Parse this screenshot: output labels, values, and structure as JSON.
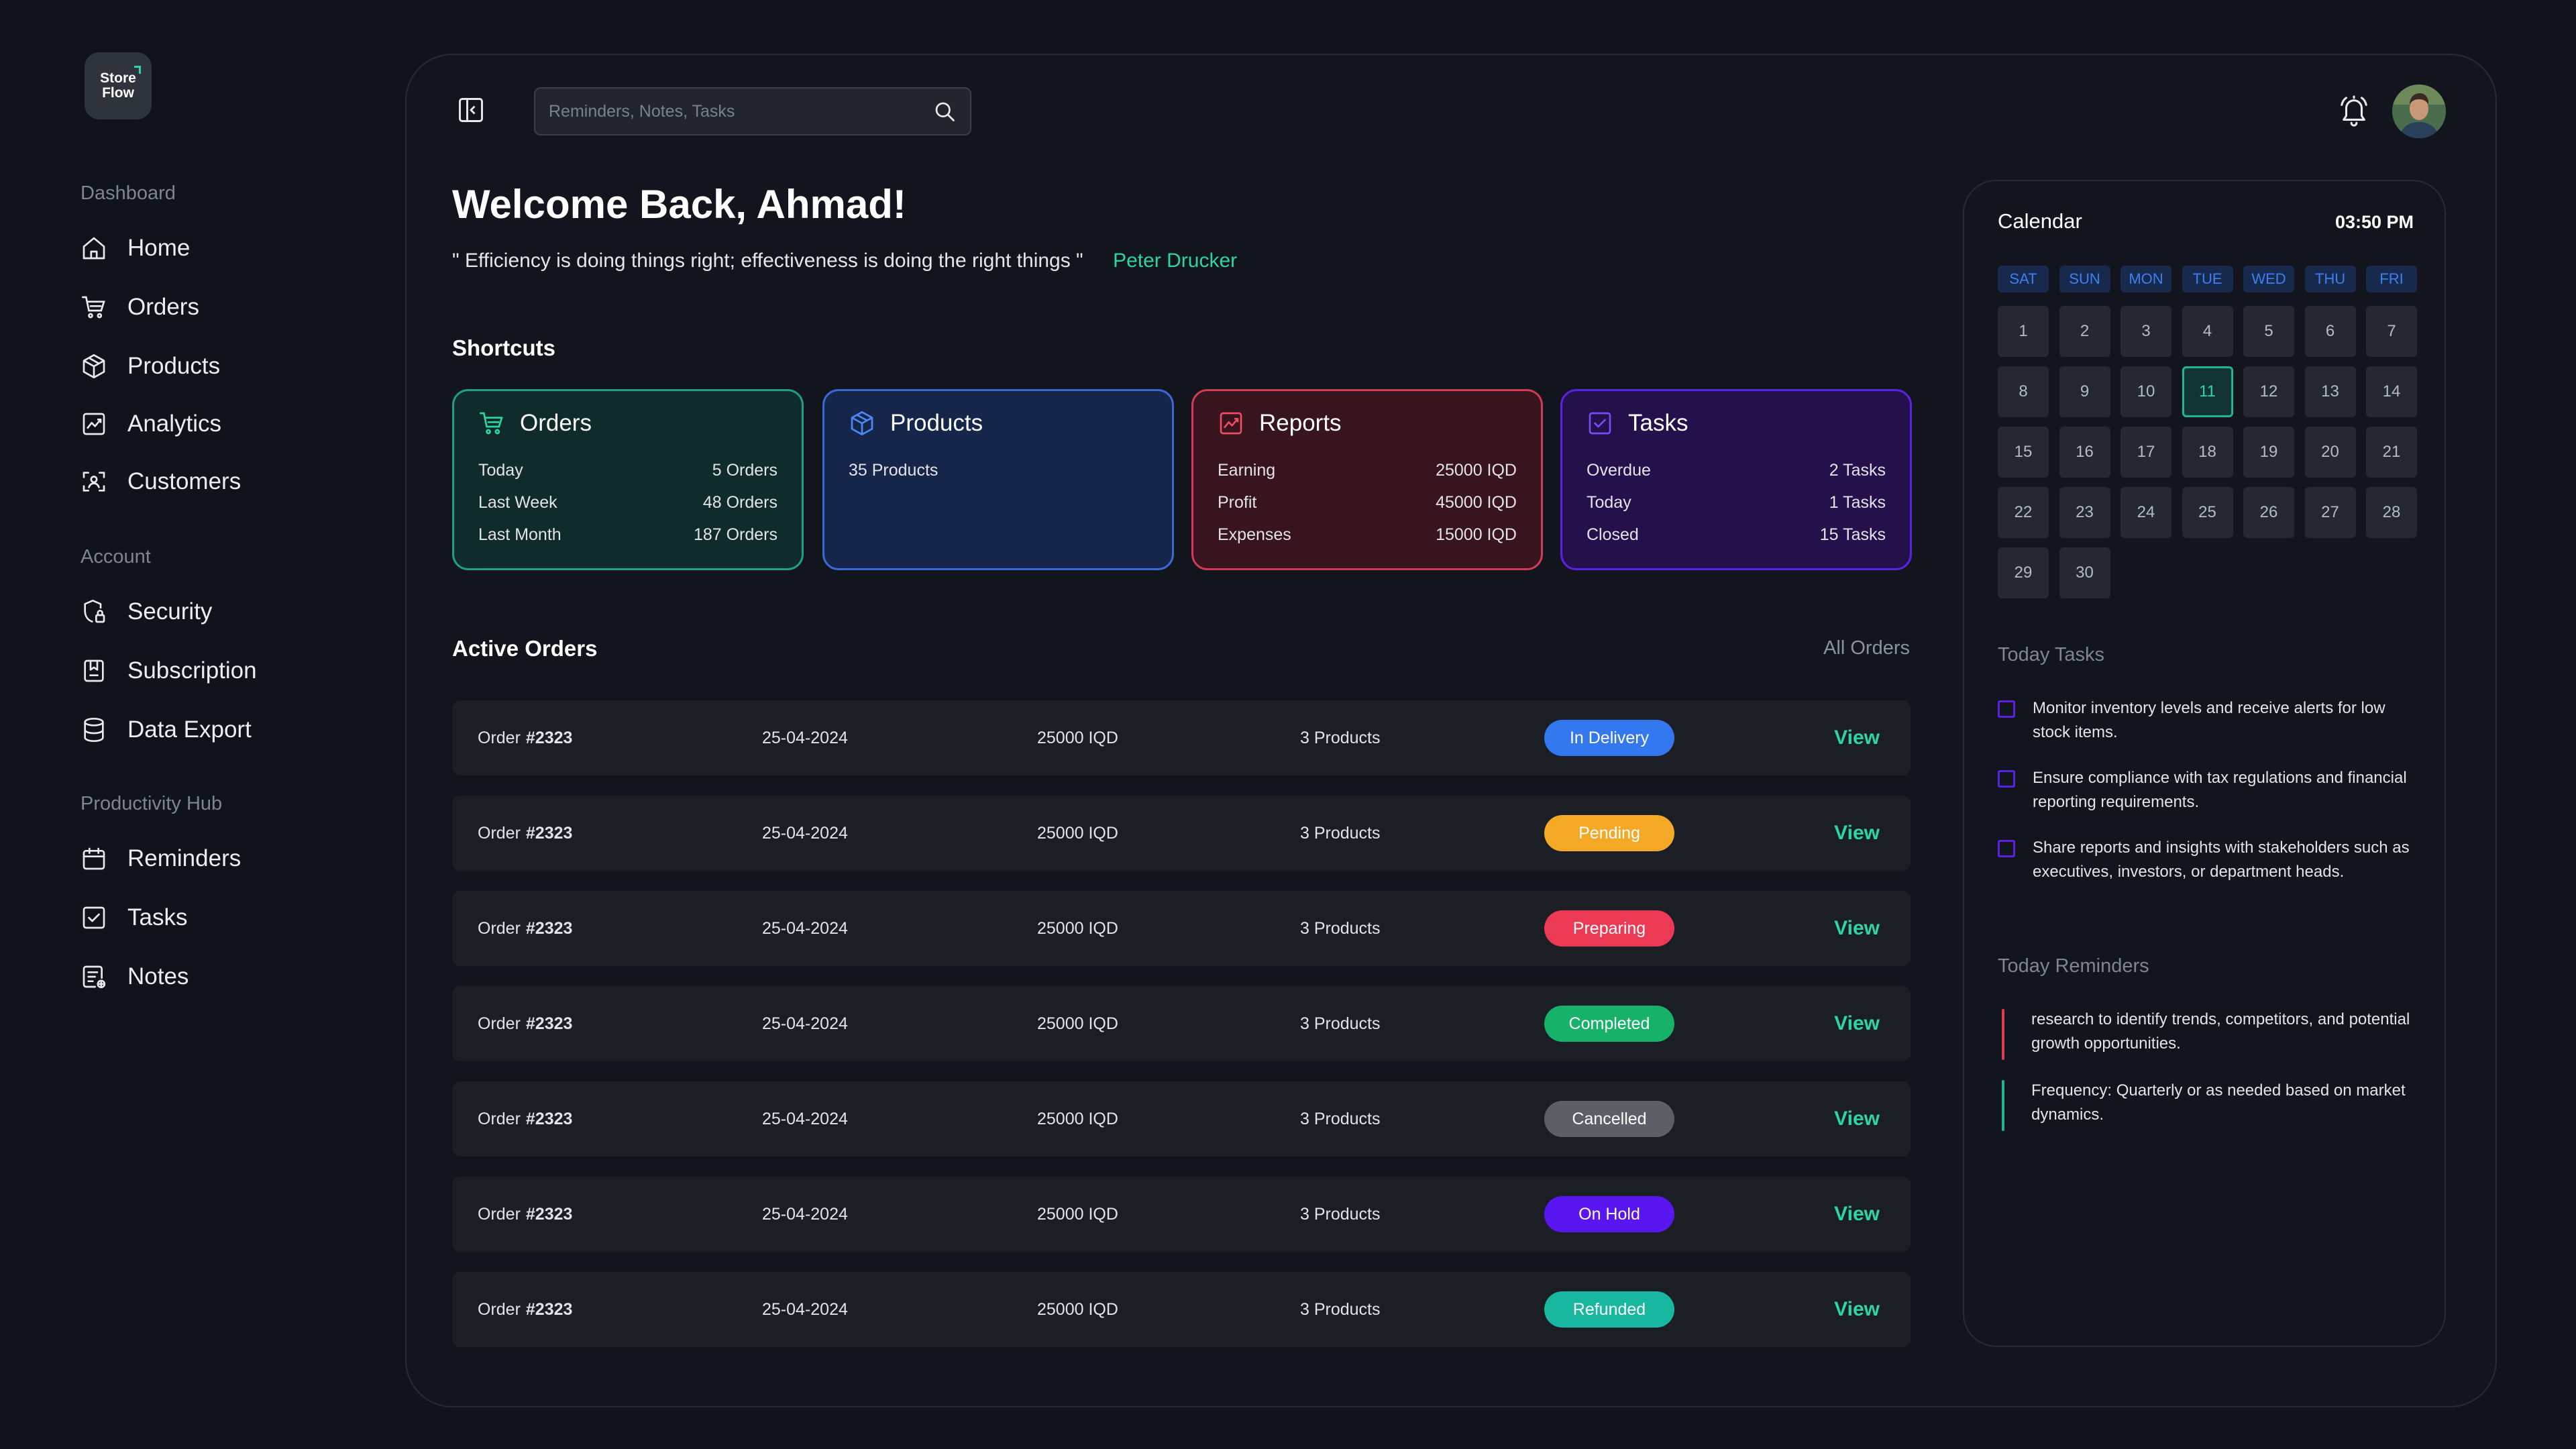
{
  "logo": {
    "line1": "Store",
    "line2": "Flow"
  },
  "sidebar": {
    "sections": [
      {
        "label": "Dashboard",
        "items": [
          "Home",
          "Orders",
          "Products",
          "Analytics",
          "Customers"
        ]
      },
      {
        "label": "Account",
        "items": [
          "Security",
          "Subscription",
          "Data Export"
        ]
      },
      {
        "label": "Productivity Hub",
        "items": [
          "Reminders",
          "Tasks",
          "Notes"
        ]
      }
    ],
    "icons": {
      "Home": "home-icon",
      "Orders": "cart-icon",
      "Products": "box-icon",
      "Analytics": "chart-icon",
      "Customers": "user-scan-icon",
      "Security": "shield-lock-icon",
      "Subscription": "bookmark-icon",
      "Data Export": "database-icon",
      "Reminders": "calendar-icon",
      "Tasks": "checkbox-icon",
      "Notes": "notes-icon"
    }
  },
  "header": {
    "search_placeholder": "Reminders, Notes, Tasks",
    "icons": [
      "sidebar-toggle-icon",
      "search-icon",
      "bell-icon"
    ]
  },
  "welcome": {
    "title": "Welcome Back, Ahmad!",
    "quote": "\" Efficiency is doing things right; effectiveness is doing the right things \"",
    "author": "Peter Drucker"
  },
  "shortcuts": {
    "title": "Shortcuts",
    "orders": {
      "label": "Orders",
      "rows": [
        [
          "Today",
          "5 Orders"
        ],
        [
          "Last Week",
          "48 Orders"
        ],
        [
          "Last Month",
          "187 Orders"
        ]
      ]
    },
    "products": {
      "label": "Products",
      "rows": [
        [
          "35 Products",
          ""
        ]
      ]
    },
    "reports": {
      "label": "Reports",
      "rows": [
        [
          "Earning",
          "25000 IQD"
        ],
        [
          "Profit",
          "45000 IQD"
        ],
        [
          "Expenses",
          "15000 IQD"
        ]
      ]
    },
    "tasks": {
      "label": "Tasks",
      "rows": [
        [
          "Overdue",
          "2 Tasks"
        ],
        [
          "Today",
          "1 Tasks"
        ],
        [
          "Closed",
          "15 Tasks"
        ]
      ]
    },
    "colors": {
      "orders": "#1f9f86",
      "products": "#3a69d6",
      "reports": "#d33b54",
      "tasks": "#5b22e6"
    }
  },
  "active_orders": {
    "title": "Active Orders",
    "all_link": "All Orders",
    "view_label": "View",
    "rows": [
      {
        "prefix": "Order",
        "id": "#2323",
        "date": "25-04-2024",
        "price": "25000 IQD",
        "products": "3 Products",
        "status": "In Delivery",
        "color": "#3478f0"
      },
      {
        "prefix": "Order",
        "id": "#2323",
        "date": "25-04-2024",
        "price": "25000 IQD",
        "products": "3 Products",
        "status": "Pending",
        "color": "#f4a825"
      },
      {
        "prefix": "Order",
        "id": "#2323",
        "date": "25-04-2024",
        "price": "25000 IQD",
        "products": "3 Products",
        "status": "Preparing",
        "color": "#ec3a55"
      },
      {
        "prefix": "Order",
        "id": "#2323",
        "date": "25-04-2024",
        "price": "25000 IQD",
        "products": "3 Products",
        "status": "Completed",
        "color": "#17b26a"
      },
      {
        "prefix": "Order",
        "id": "#2323",
        "date": "25-04-2024",
        "price": "25000 IQD",
        "products": "3 Products",
        "status": "Cancelled",
        "color": "#5c5f66"
      },
      {
        "prefix": "Order",
        "id": "#2323",
        "date": "25-04-2024",
        "price": "25000 IQD",
        "products": "3 Products",
        "status": "On Hold",
        "color": "#5a16f0"
      },
      {
        "prefix": "Order",
        "id": "#2323",
        "date": "25-04-2024",
        "price": "25000 IQD",
        "products": "3 Products",
        "status": "Refunded",
        "color": "#18b8a0"
      }
    ]
  },
  "calendar": {
    "title": "Calendar",
    "time": "03:50 PM",
    "weekdays": [
      "SAT",
      "SUN",
      "MON",
      "TUE",
      "WED",
      "THU",
      "FRI"
    ],
    "days": [
      "1",
      "2",
      "3",
      "4",
      "5",
      "6",
      "7",
      "8",
      "9",
      "10",
      "11",
      "12",
      "13",
      "14",
      "15",
      "16",
      "17",
      "18",
      "19",
      "20",
      "21",
      "22",
      "23",
      "24",
      "25",
      "26",
      "27",
      "28",
      "29",
      "30"
    ],
    "selected": "11"
  },
  "today_tasks": {
    "title": "Today Tasks",
    "items": [
      "Monitor inventory levels and receive alerts for low stock items.",
      "Ensure compliance with tax regulations and financial reporting requirements.",
      "Share reports and insights with stakeholders such as executives, investors, or department heads."
    ]
  },
  "today_reminders": {
    "title": "Today Reminders",
    "items": [
      {
        "text": "research to identify trends, competitors, and potential growth opportunities.",
        "color": "#e03a52"
      },
      {
        "text": "Frequency: Quarterly or as needed based on market dynamics.",
        "color": "#1fb594"
      }
    ]
  }
}
